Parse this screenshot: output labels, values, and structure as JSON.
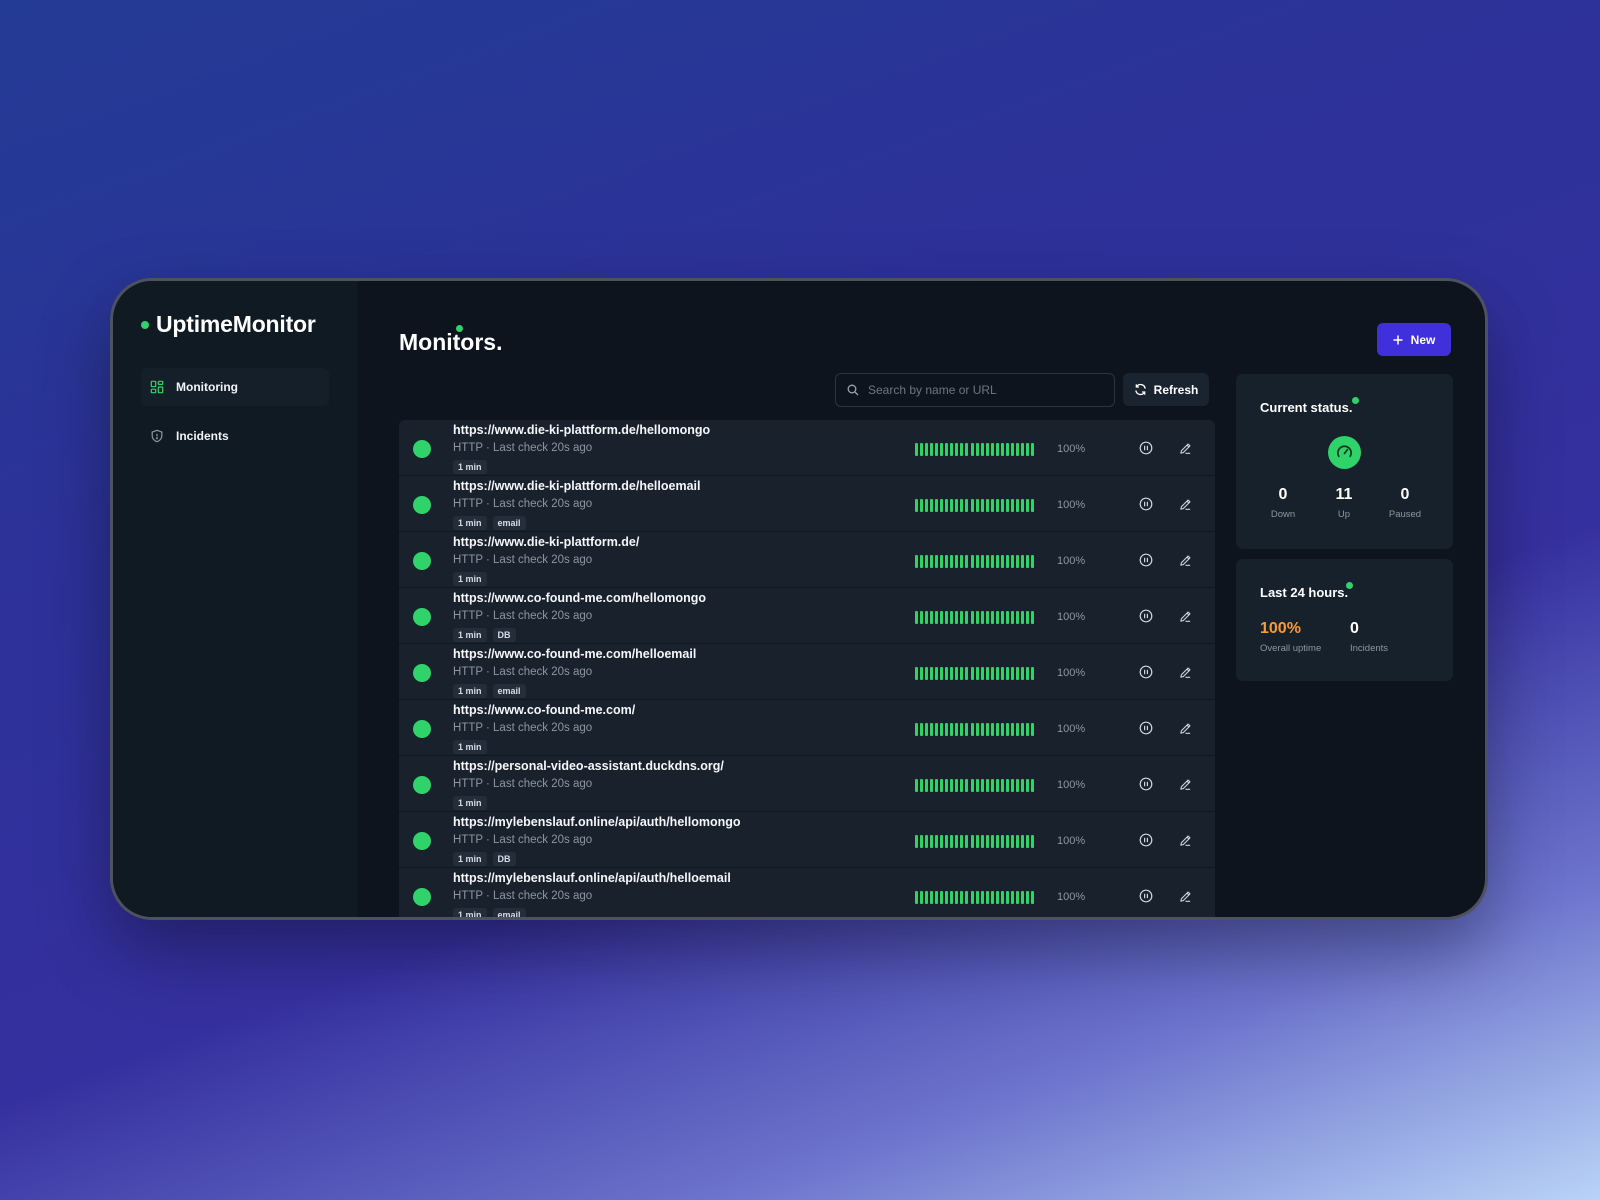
{
  "app": {
    "name": "UptimeMonitor"
  },
  "sidebar": {
    "items": [
      {
        "label": "Monitoring",
        "icon": "dashboard-icon",
        "active": true
      },
      {
        "label": "Incidents",
        "icon": "shield-icon",
        "active": false
      }
    ]
  },
  "header": {
    "title": "Monitors.",
    "new_label": "New",
    "search_placeholder": "Search by name or URL",
    "refresh_label": "Refresh"
  },
  "monitors": [
    {
      "url": "https://www.die-ki-plattform.de/hellomongo",
      "meta": "HTTP · Last check 20s ago",
      "tags": [
        "1 min"
      ],
      "uptime": "100%"
    },
    {
      "url": "https://www.die-ki-plattform.de/helloemail",
      "meta": "HTTP · Last check 20s ago",
      "tags": [
        "1 min",
        "email"
      ],
      "uptime": "100%"
    },
    {
      "url": "https://www.die-ki-plattform.de/",
      "meta": "HTTP · Last check 20s ago",
      "tags": [
        "1 min"
      ],
      "uptime": "100%"
    },
    {
      "url": "https://www.co-found-me.com/hellomongo",
      "meta": "HTTP · Last check 20s ago",
      "tags": [
        "1 min",
        "DB"
      ],
      "uptime": "100%"
    },
    {
      "url": "https://www.co-found-me.com/helloemail",
      "meta": "HTTP · Last check 20s ago",
      "tags": [
        "1 min",
        "email"
      ],
      "uptime": "100%"
    },
    {
      "url": "https://www.co-found-me.com/",
      "meta": "HTTP · Last check 20s ago",
      "tags": [
        "1 min"
      ],
      "uptime": "100%"
    },
    {
      "url": "https://personal-video-assistant.duckdns.org/",
      "meta": "HTTP · Last check 20s ago",
      "tags": [
        "1 min"
      ],
      "uptime": "100%"
    },
    {
      "url": "https://mylebenslauf.online/api/auth/hellomongo",
      "meta": "HTTP · Last check 20s ago",
      "tags": [
        "1 min",
        "DB"
      ],
      "uptime": "100%"
    },
    {
      "url": "https://mylebenslauf.online/api/auth/helloemail",
      "meta": "HTTP · Last check 20s ago",
      "tags": [
        "1 min",
        "email"
      ],
      "uptime": "100%"
    }
  ],
  "current_status": {
    "title": "Current status.",
    "down": {
      "value": "0",
      "label": "Down"
    },
    "up": {
      "value": "11",
      "label": "Up"
    },
    "paused": {
      "value": "0",
      "label": "Paused"
    }
  },
  "last_24h": {
    "title": "Last 24 hours.",
    "uptime": {
      "value": "100%",
      "label": "Overall uptime"
    },
    "incidents": {
      "value": "0",
      "label": "Incidents"
    }
  },
  "colors": {
    "accent": "#4030dc",
    "up": "#2fd36a",
    "uptime_highlight": "#f79a36"
  }
}
